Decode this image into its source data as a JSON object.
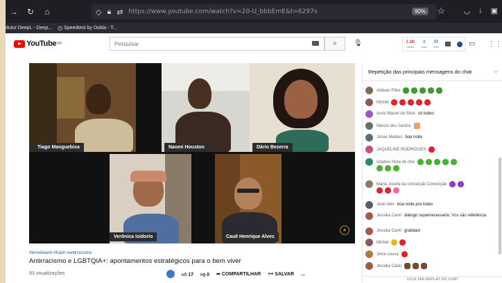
{
  "browser": {
    "url": "https://www.youtube.com/watch?v=20-U_bbbEmE&t=6297s",
    "zoom": "90%",
    "bookmarks": [
      "dutor DeepL - Deep...",
      "Speedtest by Ookla - T..."
    ]
  },
  "header": {
    "logo_text": "YouTube",
    "logo_country": "BR",
    "search_placeholder": "Pesquisar",
    "stats": [
      {
        "value": "1.1K",
        "label": "Views"
      },
      {
        "value": "3",
        "label": "Likes"
      },
      {
        "value": "37",
        "label": "Wks"
      }
    ]
  },
  "participants": [
    "Tiago Manguebixa",
    "Naomi Houston",
    "Dário Bezerra",
    "Verônica Isidorio",
    "Cauê Henrique Alves"
  ],
  "video": {
    "tags": "#terreiokariri #Kariri #antirracismo",
    "title": "Antirracismo e LGBTQIA+: apontamentos estratégicos para o bem viver",
    "views": "93 visualizações",
    "likes": "17",
    "dislikes": "0",
    "share_label": "COMPARTILHAR",
    "save_label": "SALVAR",
    "more": "..."
  },
  "chat": {
    "header": "Repetição das principais mensagens do chat",
    "replay_label": "OCULTAR REPLAY DO CHAT",
    "messages": [
      {
        "author": "Aldivan Filho",
        "text": "",
        "avatar": "#7b6b50",
        "emoji": [
          "clover",
          "clover",
          "clover",
          "clover",
          "clover"
        ]
      },
      {
        "author": "Michel",
        "text": "",
        "avatar": "#8a5a5a",
        "emoji": [
          "heart-r",
          "heart-r",
          "heart-r",
          "heart-r",
          "heart-r"
        ]
      },
      {
        "author": "Auris Maciel da Silva",
        "text": "só tudoo",
        "avatar": "#9c5bc2",
        "emoji": []
      },
      {
        "author": "Márcio dos Santos",
        "text": "",
        "avatar": "#6d6d6d",
        "emoji": [
          "cake"
        ]
      },
      {
        "author": "Jonas Mateus",
        "text": "boa noite",
        "avatar": "#5a6e7c",
        "emoji": []
      },
      {
        "author": "JAQUELINE RODRIGUES",
        "text": "",
        "avatar": "#c64f7b",
        "emoji": [
          "heart-r"
        ]
      },
      {
        "author": "colativo Hora do cha",
        "text": "",
        "avatar": "#2e8a6a",
        "emoji": [
          "heart-g",
          "heart-g",
          "heart-g",
          "heart-g",
          "heart-g",
          "heart-g",
          "heart-g",
          "heart-g"
        ]
      },
      {
        "author": "Maria Josefa da conceição Conceição",
        "text": "",
        "avatar": "#8b7a6a",
        "emoji": [
          "heart-p",
          "heart-p",
          "heart-r",
          "heart-r",
          "hearts2"
        ]
      },
      {
        "author": "Jean Alex",
        "text": "boa noite pra todes",
        "avatar": "#555e66",
        "emoji": []
      },
      {
        "author": "Jessika Cariri",
        "text": "diálogo supernecessario. Vcs são referência",
        "avatar": "#a05a4a",
        "emoji": []
      },
      {
        "author": "Jessika Cariri",
        "text": "gratidao!",
        "avatar": "#a05a4a",
        "emoji": []
      },
      {
        "author": "Michel",
        "text": "",
        "avatar": "#8a5a5a",
        "emoji": [
          "flower",
          "heart-r"
        ]
      },
      {
        "author": "Joice sousa",
        "text": "",
        "avatar": "#b4773f",
        "emoji": [
          "heart-r"
        ]
      },
      {
        "author": "Jessika Cariri",
        "text": "",
        "avatar": "#a05a4a",
        "emoji": [
          "fist",
          "fist",
          "fist"
        ]
      }
    ]
  }
}
